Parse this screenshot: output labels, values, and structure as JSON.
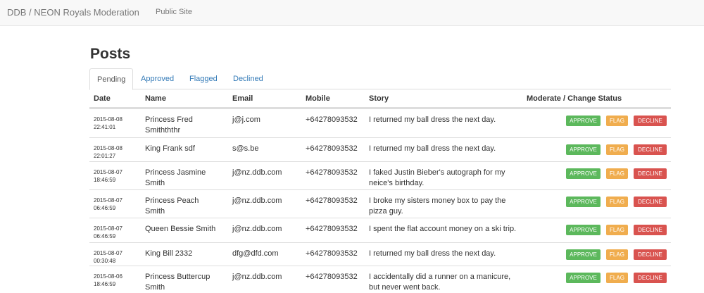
{
  "navbar": {
    "brand": "DDB / NEON Royals Moderation",
    "public_site": "Public Site"
  },
  "page": {
    "title": "Posts"
  },
  "tabs": [
    {
      "label": "Pending",
      "active": true
    },
    {
      "label": "Approved",
      "active": false
    },
    {
      "label": "Flagged",
      "active": false
    },
    {
      "label": "Declined",
      "active": false
    }
  ],
  "table": {
    "headers": {
      "date": "Date",
      "name": "Name",
      "email": "Email",
      "mobile": "Mobile",
      "story": "Story",
      "moderate": "Moderate / Change Status"
    },
    "actions": {
      "approve": "APPROVE",
      "flag": "FLAG",
      "decline": "DECLINE"
    },
    "rows": [
      {
        "date": "2015-08-08 22:41:01",
        "name": "Princess Fred Smithththr",
        "email": "j@j.com",
        "mobile": "+64278093532",
        "story": "I returned my ball dress the next day."
      },
      {
        "date": "2015-08-08 22:01:27",
        "name": "King Frank sdf",
        "email": "s@s.be",
        "mobile": "+64278093532",
        "story": "I returned my ball dress the next day."
      },
      {
        "date": "2015-08-07 18:46:59",
        "name": "Princess Jasmine Smith",
        "email": "j@nz.ddb.com",
        "mobile": "+64278093532",
        "story": "I faked Justin Bieber's autograph for my neice's birthday."
      },
      {
        "date": "2015-08-07 06:46:59",
        "name": "Princess Peach Smith",
        "email": "j@nz.ddb.com",
        "mobile": "+64278093532",
        "story": "I broke my sisters money box to pay the pizza guy."
      },
      {
        "date": "2015-08-07 06:46:59",
        "name": "Queen Bessie Smith",
        "email": "j@nz.ddb.com",
        "mobile": "+64278093532",
        "story": "I spent the flat account money on a ski trip."
      },
      {
        "date": "2015-08-07 00:30:48",
        "name": "King Bill 2332",
        "email": "dfg@dfd.com",
        "mobile": "+64278093532",
        "story": "I returned my ball dress the next day."
      },
      {
        "date": "2015-08-06 18:46:59",
        "name": "Princess Buttercup Smith",
        "email": "j@nz.ddb.com",
        "mobile": "+64278093532",
        "story": "I accidentally did a runner on a manicure, but never went back."
      }
    ]
  }
}
